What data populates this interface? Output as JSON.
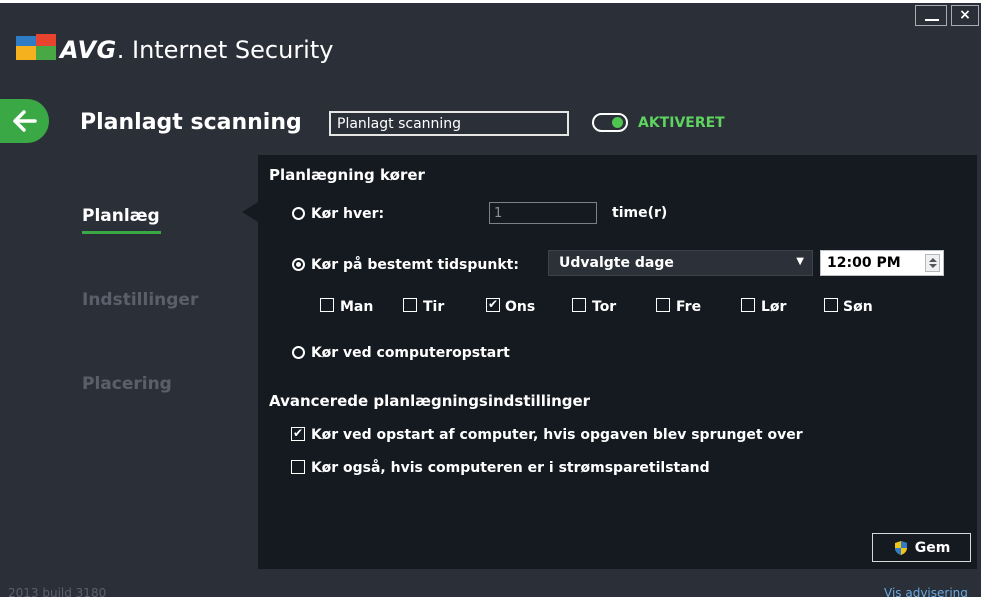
{
  "window": {
    "minimize_symbol": "",
    "close_symbol": "×"
  },
  "app": {
    "brand": "AVG",
    "product": "Internet Security"
  },
  "header": {
    "title": "Planlagt scanning",
    "name_value": "Planlagt scanning",
    "toggle_state": "on",
    "toggle_label": "AKTIVERET"
  },
  "nav": {
    "items": [
      {
        "label": "Planlæg",
        "active": true
      },
      {
        "label": "Indstillinger",
        "active": false
      },
      {
        "label": "Placering",
        "active": false
      }
    ]
  },
  "schedule": {
    "section_title": "Planlægning kører",
    "run_every_label": "Kør hver:",
    "run_every_value": "1",
    "run_every_unit": "time(r)",
    "run_at_label": "Kør på bestemt tidspunkt:",
    "days_select_value": "Udvalgte dage",
    "time_value": "12:00 PM",
    "days": [
      {
        "label": "Man",
        "checked": false
      },
      {
        "label": "Tir",
        "checked": false
      },
      {
        "label": "Ons",
        "checked": true
      },
      {
        "label": "Tor",
        "checked": false
      },
      {
        "label": "Fre",
        "checked": false
      },
      {
        "label": "Lør",
        "checked": false
      },
      {
        "label": "Søn",
        "checked": false
      }
    ],
    "run_on_startup_label": "Kør ved computeropstart",
    "selected_mode": "run_at"
  },
  "advanced": {
    "section_title": "Avancerede planlægningsindstillinger",
    "opt1_label": "Kør ved opstart af computer, hvis opgaven blev sprunget over",
    "opt1_checked": true,
    "opt2_label": "Kør også, hvis computeren er i strømsparetilstand",
    "opt2_checked": false
  },
  "save_label": "Gem",
  "footer": {
    "build": "2013 build 3180",
    "link": "Vis advisering"
  },
  "colors": {
    "window_bg": "#2b3038",
    "panel_bg": "#151a20",
    "accent_green": "#3aa945",
    "toggle_text": "#5fd35f",
    "link": "#6aa9e0"
  }
}
